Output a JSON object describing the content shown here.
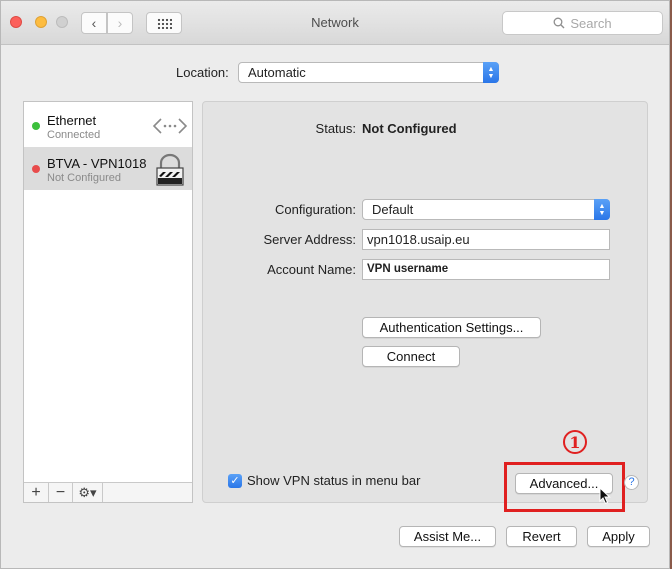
{
  "window": {
    "title": "Network"
  },
  "search": {
    "placeholder": "Search"
  },
  "location": {
    "label": "Location:",
    "value": "Automatic"
  },
  "services": [
    {
      "name": "Ethernet",
      "status": "Connected",
      "dot_color": "#3cc03c",
      "icon": "ethernet-arrows-icon"
    },
    {
      "name": "BTVA - VPN1018",
      "status": "Not Configured",
      "dot_color": "#e84c4c",
      "icon": "vpn-lock-icon",
      "selected": true
    }
  ],
  "sidebar_toolbar": {
    "add": "+",
    "remove": "−",
    "action": "⚙▾"
  },
  "detail": {
    "status_label": "Status:",
    "status_value": "Not Configured",
    "configuration_label": "Configuration:",
    "configuration_value": "Default",
    "server_label": "Server Address:",
    "server_value": "vpn1018.usaip.eu",
    "account_label": "Account Name:",
    "account_value": "VPN username",
    "auth_button": "Authentication Settings...",
    "connect_button": "Connect",
    "show_status_label": "Show VPN status in menu bar",
    "show_status_checked": true,
    "advanced_button": "Advanced...",
    "help": "?"
  },
  "annotation": {
    "marker": "①",
    "color": "#e02020"
  },
  "footer": {
    "assist": "Assist Me...",
    "revert": "Revert",
    "apply": "Apply"
  }
}
